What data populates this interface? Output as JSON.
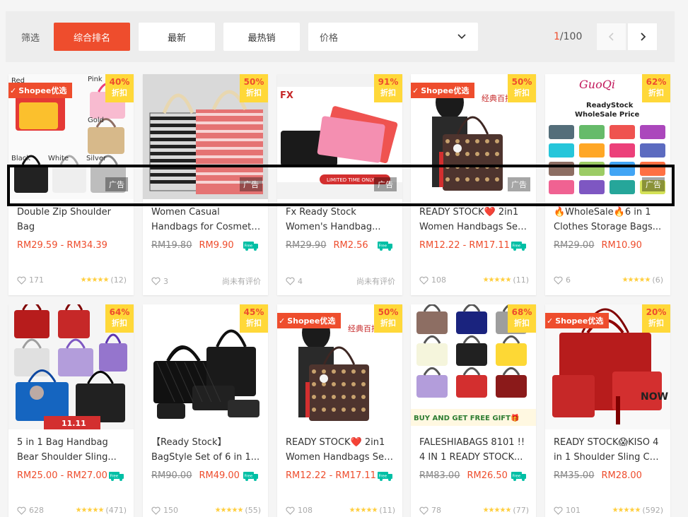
{
  "sortbar": {
    "label": "筛选",
    "buttons": [
      "综合排名",
      "最新",
      "最热销"
    ],
    "price_select": "价格",
    "page_current": "1",
    "page_total": "/100"
  },
  "colors": {
    "accent": "#ee4d2d",
    "discount_bg": "#ffd839",
    "star": "#ffce3d",
    "free_ship": "#00bfa5"
  },
  "products": [
    {
      "discount": "40%",
      "discount_label": "折扣",
      "mall": "Shopee优选",
      "ad": "广告",
      "title1": "Double Zip Shoulder",
      "title2": "Bag",
      "orig_price": "",
      "price": "RM29.59 - RM34.39",
      "free": false,
      "likes": "171",
      "rating_count": "(12)",
      "no_rating": ""
    },
    {
      "discount": "50%",
      "discount_label": "折扣",
      "mall": "",
      "ad": "广告",
      "title1": "Women Casual",
      "title2": "Handbags for Cosmeti...",
      "orig_price": "RM19.80",
      "price": "RM9.90",
      "free": true,
      "likes": "3",
      "rating_count": "",
      "no_rating": "尚未有评价"
    },
    {
      "discount": "91%",
      "discount_label": "折扣",
      "mall": "",
      "ad": "广告",
      "title1": "Fx Ready Stock",
      "title2": "Women's Handbag...",
      "orig_price": "RM29.90",
      "price": "RM2.56",
      "free": true,
      "likes": "4",
      "rating_count": "",
      "no_rating": "尚未有评价"
    },
    {
      "discount": "50%",
      "discount_label": "折扣",
      "mall": "Shopee优选",
      "ad": "广告",
      "title1": "READY STOCK❤️ 2in1",
      "title2": "Women Handbags Set...",
      "orig_price": "",
      "price": "RM12.22 - RM17.11",
      "free": true,
      "likes": "108",
      "rating_count": "(11)",
      "no_rating": ""
    },
    {
      "discount": "62%",
      "discount_label": "折扣",
      "mall": "",
      "ad": "广告",
      "title1": "🔥WholeSale🔥6 in 1",
      "title2": "Clothes Storage Bags...",
      "orig_price": "RM29.00",
      "price": "RM10.90",
      "free": false,
      "likes": "6",
      "rating_count": "(6)",
      "no_rating": ""
    },
    {
      "discount": "64%",
      "discount_label": "折扣",
      "mall": "",
      "ad": "",
      "title1": "5 in 1 Bag Handbag",
      "title2": "Bear Shoulder Sling...",
      "orig_price": "",
      "price": "RM25.00 - RM27.00",
      "free": true,
      "likes": "628",
      "rating_count": "(471)",
      "no_rating": ""
    },
    {
      "discount": "45%",
      "discount_label": "折扣",
      "mall": "",
      "ad": "",
      "title1": "【Ready Stock】",
      "title2": "BagStyle Set of 6 in 1...",
      "orig_price": "RM90.00",
      "price": "RM49.00",
      "free": true,
      "likes": "150",
      "rating_count": "(55)",
      "no_rating": ""
    },
    {
      "discount": "50%",
      "discount_label": "折扣",
      "mall": "Shopee优选",
      "ad": "",
      "title1": "READY STOCK❤️ 2in1",
      "title2": "Women Handbags Set...",
      "orig_price": "",
      "price": "RM12.22 - RM17.11",
      "free": true,
      "likes": "108",
      "rating_count": "(11)",
      "no_rating": ""
    },
    {
      "discount": "68%",
      "discount_label": "折扣",
      "mall": "",
      "ad": "",
      "title1": "FALESHIABAGS 8101 !!",
      "title2": "4 IN 1 READY STOCK...",
      "orig_price": "RM83.00",
      "price": "RM26.50",
      "free": true,
      "likes": "78",
      "rating_count": "(77)",
      "no_rating": ""
    },
    {
      "discount": "20%",
      "discount_label": "折扣",
      "mall": "Shopee优选",
      "ad": "",
      "title1": "READY STOCK😱KISO 4",
      "title2": "in 1 Shoulder Sling Cut...",
      "orig_price": "RM35.00",
      "price": "RM28.00",
      "free": false,
      "likes": "101",
      "rating_count": "(592)",
      "no_rating": ""
    }
  ],
  "image_text": {
    "p0_colors": [
      "Red",
      "Pink",
      "Gold",
      "Black",
      "White",
      "Silver"
    ],
    "p2_brand": "FX",
    "p2_banner": "LIMITED TIME ONLY",
    "p3_cn": "经典百搭",
    "p4_brand": "GuoQi",
    "p4_line1": "ReadyStock",
    "p4_line2": "WholeSale Price",
    "p5_banner": "11.11",
    "p7_cn": "经典百搭",
    "p8_banner": "BUY AND GET FREE GIFT🎁",
    "p9_text": "NOW"
  },
  "free_label": "Free"
}
